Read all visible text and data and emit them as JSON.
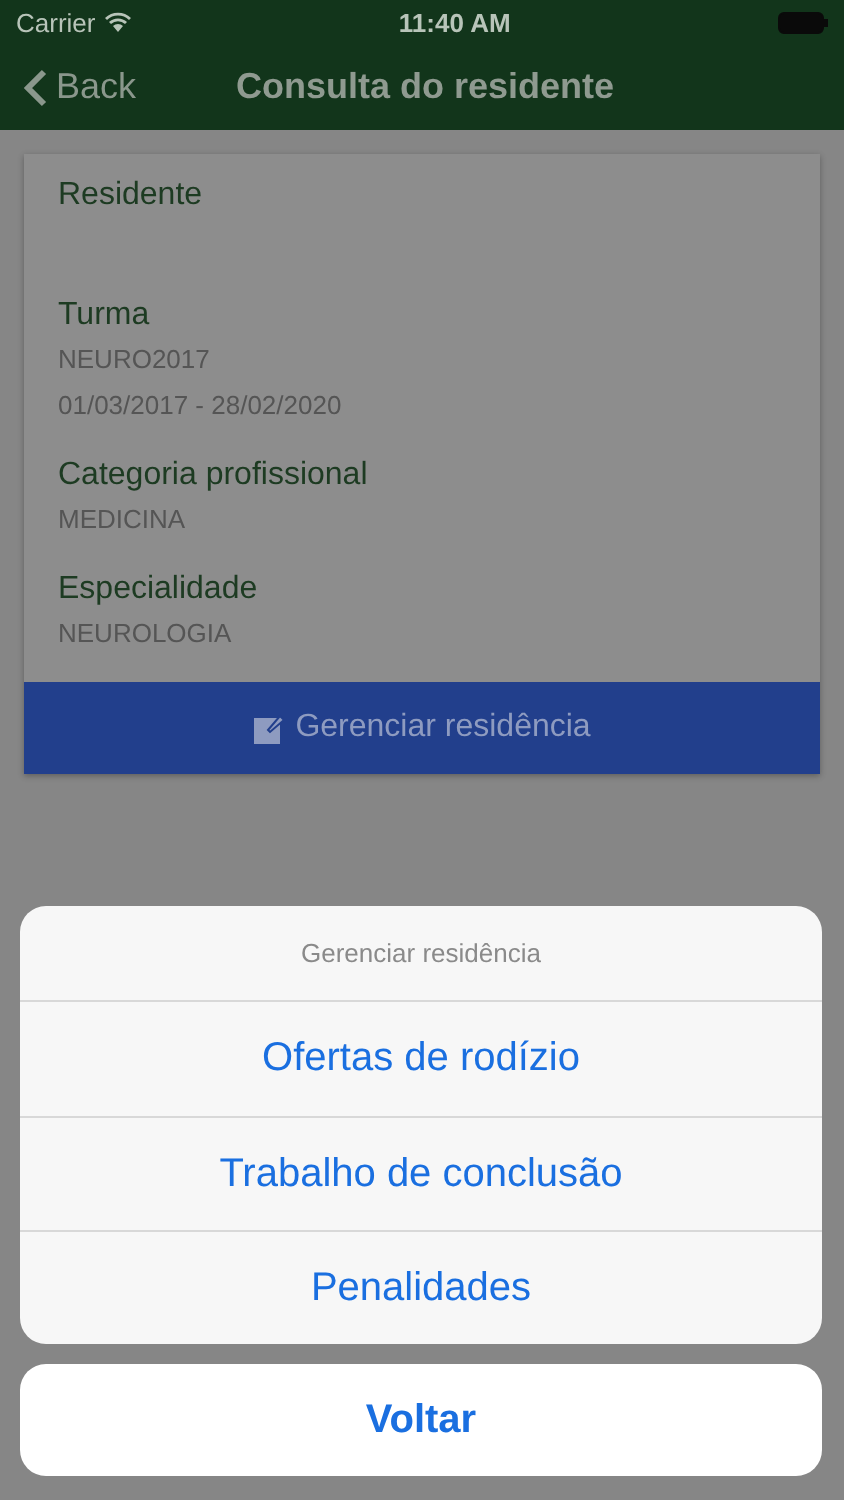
{
  "status_bar": {
    "carrier": "Carrier",
    "time": "11:40 AM"
  },
  "nav": {
    "back": "Back",
    "title": "Consulta do residente"
  },
  "fields": [
    {
      "label": "Residente"
    },
    {
      "label": "Turma",
      "values": [
        "NEURO2017",
        "01/03/2017 - 28/02/2020"
      ]
    },
    {
      "label": "Categoria profissional",
      "values": [
        "MEDICINA"
      ]
    },
    {
      "label": "Especialidade",
      "values": [
        "NEUROLOGIA"
      ]
    }
  ],
  "manage_button": "Gerenciar residência",
  "action_sheet": {
    "title": "Gerenciar residência",
    "actions": [
      "Ofertas de rodízio",
      "Trabalho de conclusão",
      "Penalidades"
    ],
    "cancel": "Voltar"
  }
}
